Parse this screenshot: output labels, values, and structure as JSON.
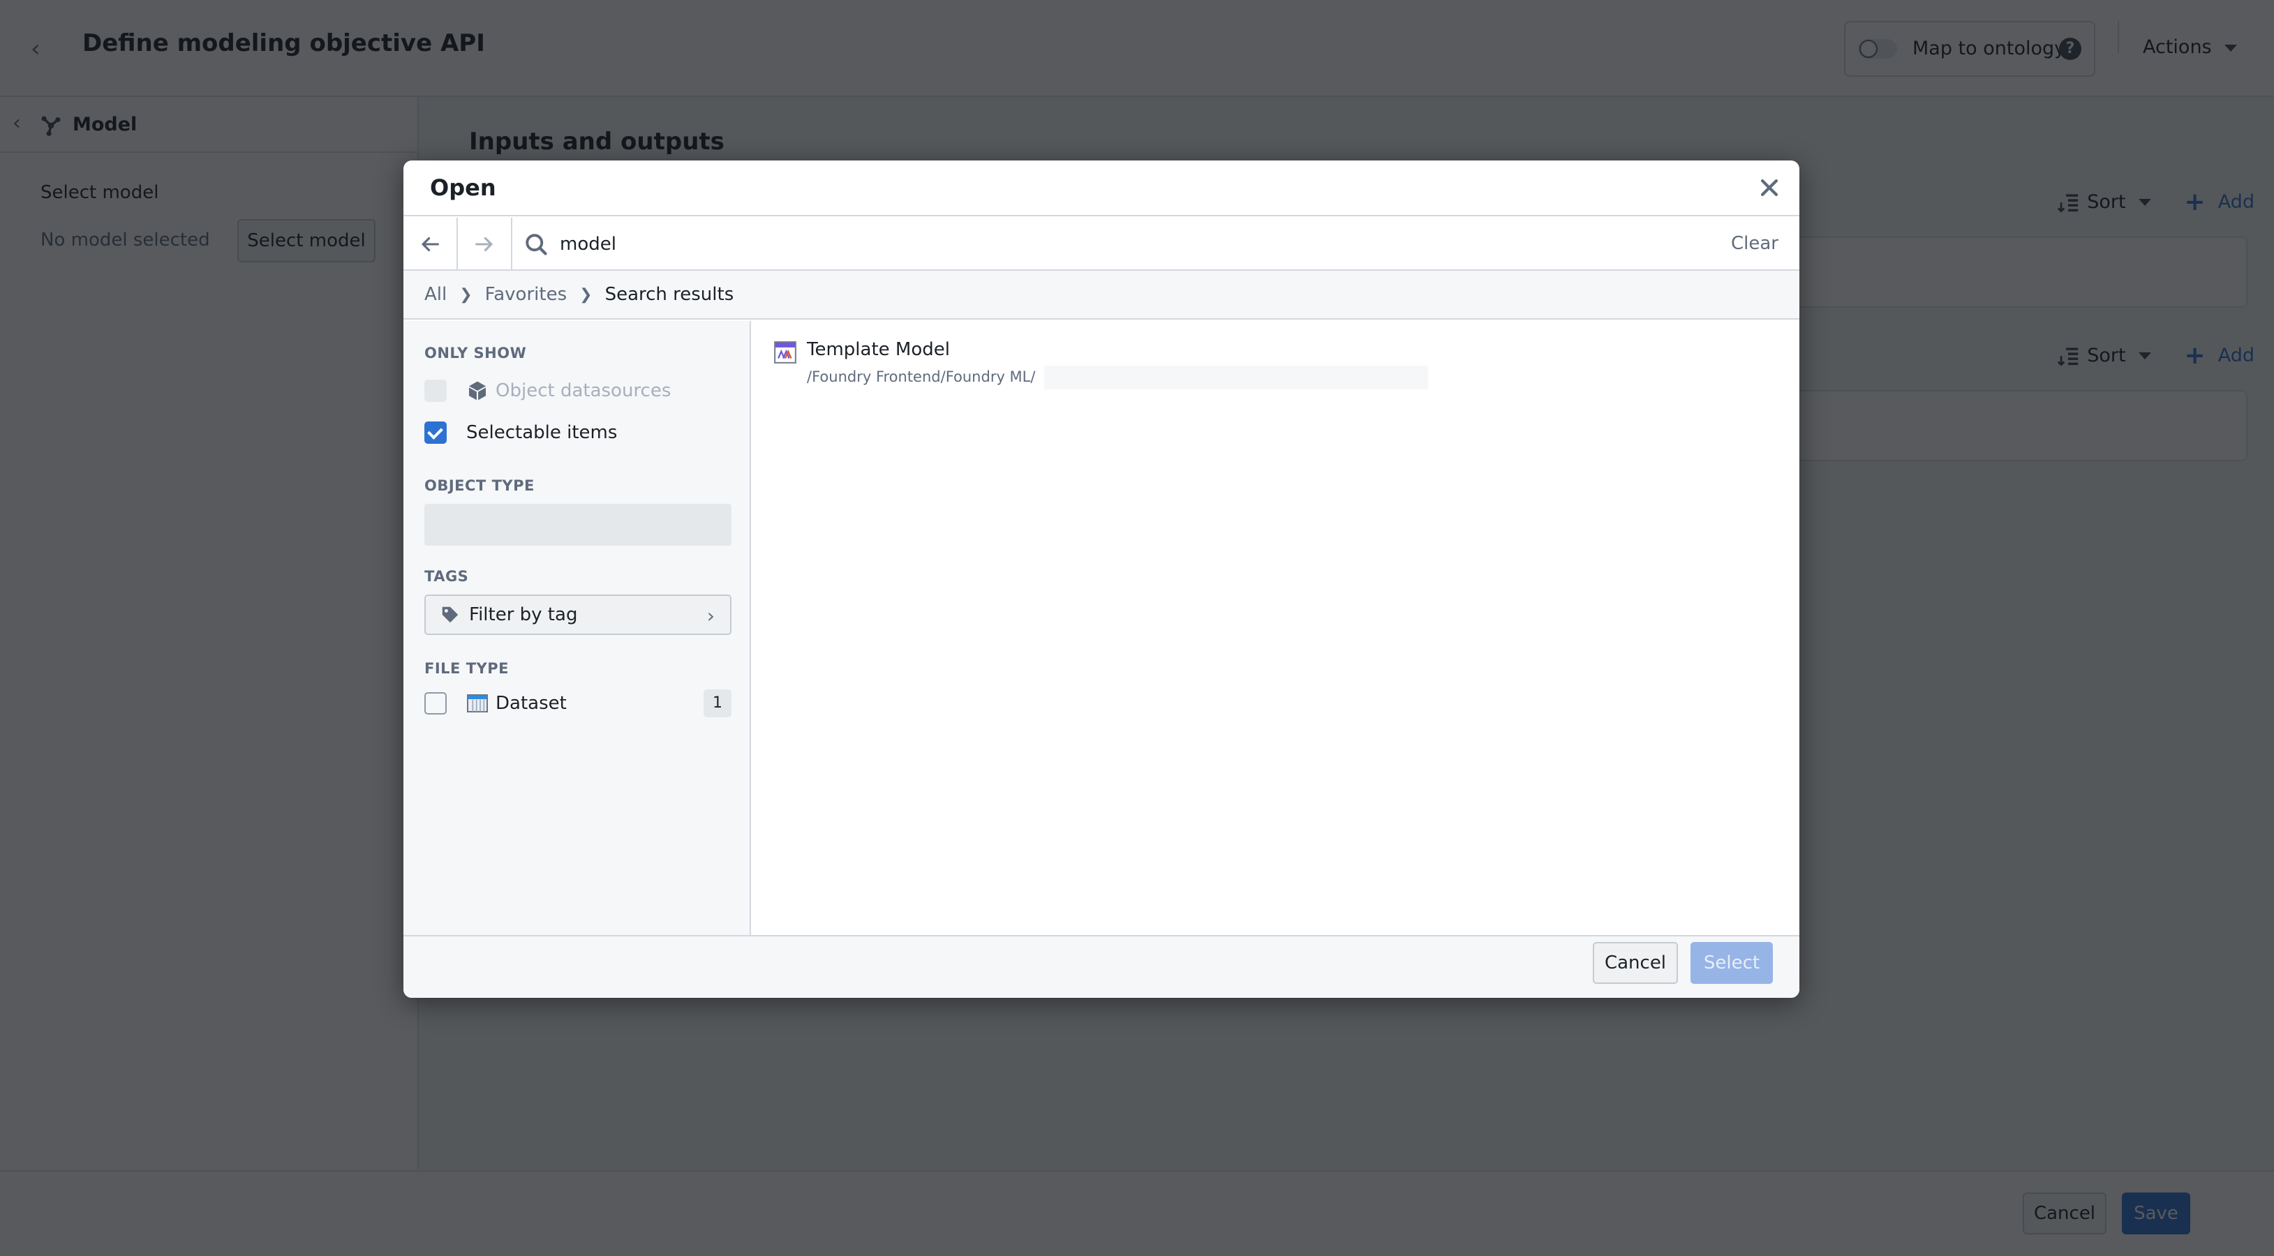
{
  "app": {
    "title": "Define modeling objective API",
    "map_to_ontology": {
      "label": "Map to ontology",
      "enabled": false,
      "help_icon": "question-icon"
    },
    "actions_label": "Actions"
  },
  "left_panel": {
    "header_label": "Model",
    "header_icon": "model-icon",
    "field_label": "Select model",
    "empty_text": "No model selected",
    "select_button": "Select model"
  },
  "main": {
    "section_title": "Inputs and outputs",
    "toolbars": [
      {
        "sort_label": "Sort",
        "add_label": "Add"
      },
      {
        "sort_label": "Sort",
        "add_label": "Add"
      }
    ]
  },
  "footer": {
    "cancel_label": "Cancel",
    "save_label": "Save"
  },
  "dialog": {
    "title": "Open",
    "search": {
      "value": "model",
      "placeholder": "",
      "clear_label": "Clear"
    },
    "breadcrumb": [
      {
        "label": "All"
      },
      {
        "label": "Favorites"
      },
      {
        "label": "Search results"
      }
    ],
    "filters": {
      "only_show_heading": "ONLY SHOW",
      "only_show": [
        {
          "label": "Object datasources",
          "checked": false,
          "disabled": true,
          "icon": "cube-icon"
        },
        {
          "label": "Selectable items",
          "checked": true,
          "disabled": false
        }
      ],
      "object_type_heading": "OBJECT TYPE",
      "object_type_value": "",
      "tags_heading": "TAGS",
      "tags_button": "Filter by tag",
      "file_type_heading": "FILE TYPE",
      "file_types": [
        {
          "label": "Dataset",
          "checked": false,
          "count": "1",
          "icon": "dataset-icon"
        }
      ]
    },
    "results": [
      {
        "title": "Template Model",
        "path": "/Foundry Frontend/Foundry ML/",
        "icon": "model-file-icon"
      }
    ],
    "cancel_label": "Cancel",
    "select_label": "Select"
  },
  "colors": {
    "primary": "#2d72d2",
    "primary_disabled": "#97b4e6",
    "text": "#1c2127",
    "muted": "#5f6b7c",
    "overlay": "#111418"
  }
}
